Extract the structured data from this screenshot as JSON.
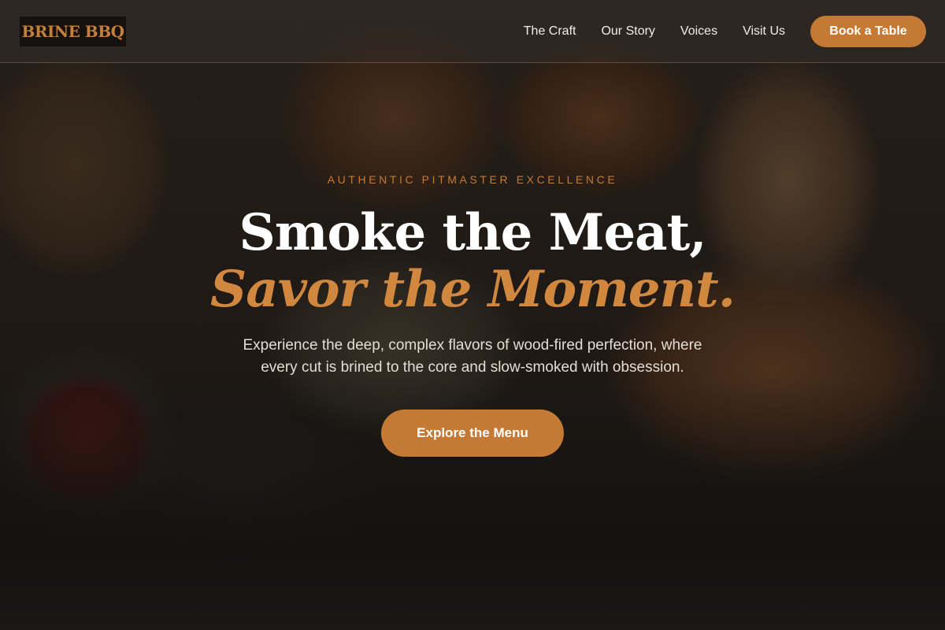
{
  "brand": {
    "logo_text": "BRINE BBQ"
  },
  "nav": {
    "links": [
      "The Craft",
      "Our Story",
      "Voices",
      "Visit Us"
    ],
    "cta_label": "Book a Table"
  },
  "hero": {
    "eyebrow": "AUTHENTIC PITMASTER EXCELLENCE",
    "title_line1": "Smoke the Meat,",
    "title_line2": "Savor the Moment.",
    "description_line1": "Experience the deep, complex flavors of wood-fired perfection, where",
    "description_line2": "every cut is brined to the core and slow-smoked with obsession.",
    "cta_label": "Explore the Menu"
  },
  "colors": {
    "accent": "#c47a35",
    "accent_title": "#d2873f",
    "header_bg": "#342e2a",
    "text_light": "#f2ece6"
  }
}
